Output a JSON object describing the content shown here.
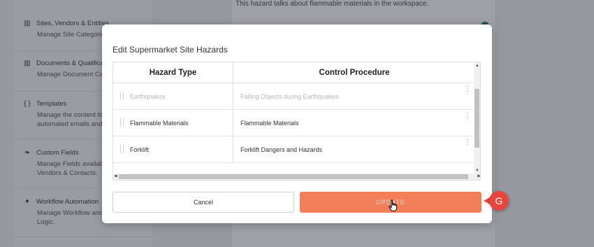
{
  "background": {
    "sidebar_items": [
      {
        "icon": "building-icon",
        "glyph": "▥",
        "title": "Sites, Vendors & Entities",
        "desc": [
          "Manage Site Categories."
        ]
      },
      {
        "icon": "books-icon",
        "glyph": "▥",
        "title": "Documents & Qualificati",
        "desc": [
          "Manage Document Cate"
        ]
      },
      {
        "icon": "braces-icon",
        "glyph": "{ }",
        "title": "Templates",
        "desc": [
          "Manage the content fou",
          "automated emails and c"
        ]
      },
      {
        "icon": "leaf-icon",
        "glyph": "❧",
        "title": "Custom Fields",
        "desc": [
          "Manage Fields available",
          "Vendors & Contacts."
        ]
      },
      {
        "icon": "magic-wand-icon",
        "glyph": "✦",
        "title": "Workflow Automation",
        "desc": [
          "Manage Workflow and a",
          "Logic."
        ]
      }
    ],
    "content_text": "This hazard talks about flammable materials in the workspace."
  },
  "modal": {
    "title": "Edit Supermarket Site Hazards",
    "columns": {
      "hazard": "Hazard Type",
      "control": "Control Procedure"
    },
    "rows": [
      {
        "hazard": "Earthquakes",
        "control": "Falling Objects during Earthquakes"
      },
      {
        "hazard": "Flammable Materials",
        "control": "Flammable Materials"
      },
      {
        "hazard": "Forklift",
        "control": "Forklift Dangers and Hazards"
      }
    ],
    "cancel_label": "Cancel",
    "update_label": "UPDATE"
  },
  "annotation": {
    "label": "G"
  },
  "colors": {
    "update_button": "#f37f5a",
    "badge": "#e8453c",
    "overlay": "#282c38"
  }
}
